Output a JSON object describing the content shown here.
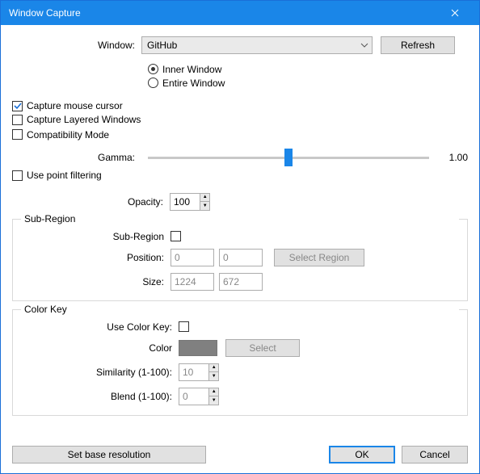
{
  "title": "Window Capture",
  "window_lbl": "Window:",
  "window_value": "GitHub",
  "refresh": "Refresh",
  "mode": {
    "inner": "Inner Window",
    "entire": "Entire Window"
  },
  "chk": {
    "mouse": "Capture mouse cursor",
    "layered": "Capture Layered Windows",
    "compat": "Compatibility Mode",
    "pointfilter": "Use point filtering"
  },
  "gamma_lbl": "Gamma:",
  "gamma_val": "1.00",
  "opacity_lbl": "Opacity:",
  "opacity_val": "100",
  "sub": {
    "legend": "Sub-Region",
    "chk": "Sub-Region",
    "pos_lbl": "Position:",
    "pos_x": "0",
    "pos_y": "0",
    "size_lbl": "Size:",
    "size_w": "1224",
    "size_h": "672",
    "select_region": "Select Region"
  },
  "ck": {
    "legend": "Color Key",
    "use": "Use Color Key:",
    "color_lbl": "Color",
    "select": "Select",
    "similarity_lbl": "Similarity (1-100):",
    "similarity_val": "10",
    "blend_lbl": "Blend (1-100):",
    "blend_val": "0"
  },
  "set_base": "Set base resolution",
  "ok": "OK",
  "cancel": "Cancel"
}
